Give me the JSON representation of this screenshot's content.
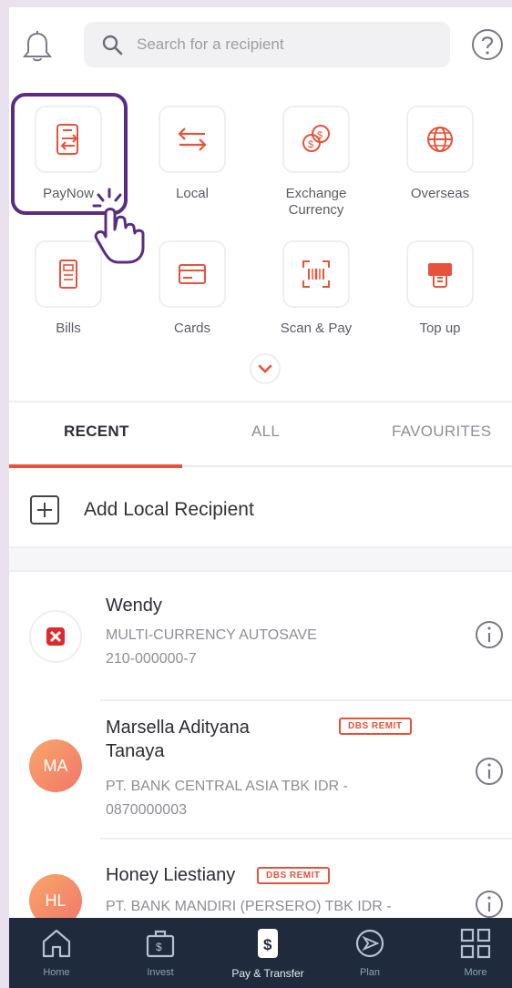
{
  "search": {
    "placeholder": "Search for a recipient"
  },
  "quick_actions": [
    {
      "label": "PayNow",
      "icon": "paynow-icon"
    },
    {
      "label": "Local",
      "icon": "local-transfer-icon"
    },
    {
      "label": "Exchange Currency",
      "icon": "exchange-currency-icon"
    },
    {
      "label": "Overseas",
      "icon": "globe-icon"
    },
    {
      "label": "Bills",
      "icon": "bill-icon"
    },
    {
      "label": "Cards",
      "icon": "card-icon"
    },
    {
      "label": "Scan & Pay",
      "icon": "scan-qr-icon"
    },
    {
      "label": "Top up",
      "icon": "top-up-icon"
    }
  ],
  "tabs": [
    {
      "label": "RECENT",
      "active": true
    },
    {
      "label": "ALL",
      "active": false
    },
    {
      "label": "FAVOURITES",
      "active": false
    }
  ],
  "add_recipient": {
    "label": "Add Local Recipient"
  },
  "recipients": [
    {
      "name": "Wendy",
      "line1": "MULTI-CURRENCY AUTOSAVE",
      "line2": "210-000000-7",
      "avatar": ""
    },
    {
      "name_line1": "Marsella Adityana",
      "name_line2": "Tanaya",
      "badge": "DBS REMIT",
      "line1": "PT. BANK CENTRAL ASIA TBK IDR -",
      "line2": "0870000003",
      "avatar": "MA"
    },
    {
      "name": "Honey Liestiany",
      "badge": "DBS REMIT",
      "line1": "PT. BANK MANDIRI (PERSERO) TBK IDR -",
      "avatar": "HL"
    }
  ],
  "bottom_nav": [
    {
      "label": "Home",
      "active": false
    },
    {
      "label": "Invest",
      "active": false
    },
    {
      "label": "Pay & Transfer",
      "active": true
    },
    {
      "label": "Plan",
      "active": false
    },
    {
      "label": "More",
      "active": false
    }
  ],
  "colors": {
    "accent": "#e8523b",
    "highlight": "#5b2c83",
    "nav_bg": "#1f2b3d"
  }
}
